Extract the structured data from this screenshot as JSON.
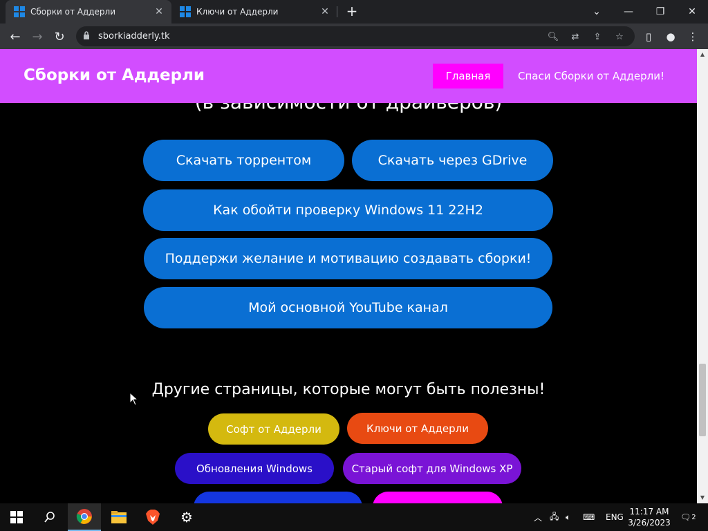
{
  "browser": {
    "tabs": [
      {
        "label": "Сборки от Аддерли",
        "active": true
      },
      {
        "label": "Ключи от Аддерли",
        "active": false
      }
    ],
    "url": "sborkiadderly.tk"
  },
  "site": {
    "title": "Сборки от Аддерли",
    "nav": {
      "home": "Главная",
      "save": "Спаси Сборки от Аддерли!"
    },
    "cut_text": "(в зависимости от драйверов)",
    "buttons": {
      "torrent": "Скачать торрентом",
      "gdrive": "Скачать через GDrive",
      "bypass": "Как обойти проверку Windows 11 22H2",
      "support": "Поддержи желание и мотивацию создавать сборки!",
      "youtube": "Мой основной YouTube канал"
    },
    "other_title": "Другие страницы, которые могут быть полезны!",
    "pills": [
      {
        "label": "Софт от Аддерли",
        "color": "#d4b90f"
      },
      {
        "label": "Ключи от Аддерли",
        "color": "#e84a12"
      },
      {
        "label": "Обновления Windows",
        "color": "#2a10c8"
      },
      {
        "label": "Старый софт для Windows XP",
        "color": "#7a14d6"
      },
      {
        "label": "",
        "color": "#1436e0"
      },
      {
        "label": "",
        "color": "#ff00ff"
      }
    ],
    "colors": {
      "header": "#d24dff",
      "button": "#0a6fd3",
      "home": "#ff00ff"
    }
  },
  "taskbar": {
    "language": "ENG",
    "time": "11:17 AM",
    "date": "3/26/2023",
    "notifications": "2"
  }
}
